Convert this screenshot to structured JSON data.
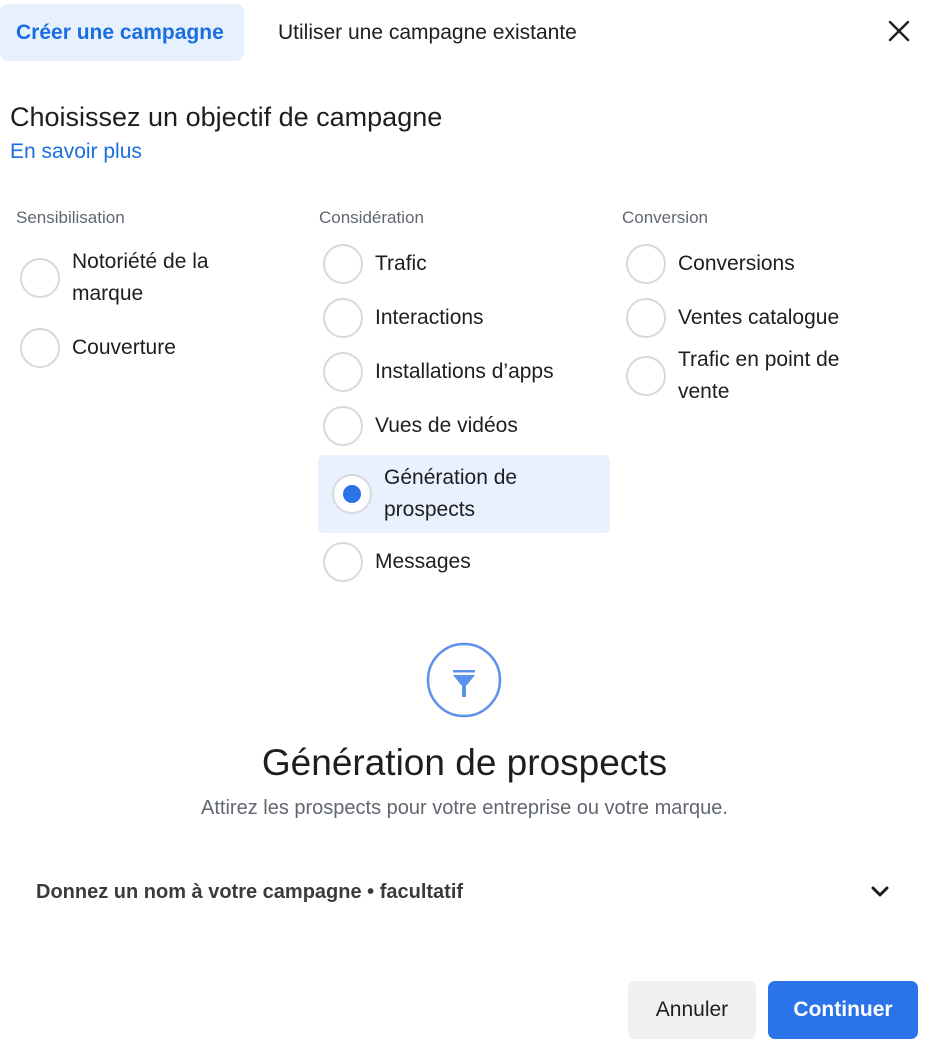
{
  "tabs": [
    {
      "label": "Créer une campagne",
      "active": true
    },
    {
      "label": "Utiliser une campagne existante",
      "active": false
    }
  ],
  "close_icon": "close-icon",
  "heading": "Choisissez un objectif de campagne",
  "learn_more": "En savoir plus",
  "columns": [
    {
      "title": "Sensibilisation",
      "options": [
        {
          "label": "Notoriété de la marque",
          "selected": false
        },
        {
          "label": "Couverture",
          "selected": false
        }
      ]
    },
    {
      "title": "Considération",
      "options": [
        {
          "label": "Trafic",
          "selected": false
        },
        {
          "label": "Interactions",
          "selected": false
        },
        {
          "label": "Installations d’apps",
          "selected": false
        },
        {
          "label": "Vues de vidéos",
          "selected": false
        },
        {
          "label": "Génération de prospects",
          "selected": true
        },
        {
          "label": "Messages",
          "selected": false
        }
      ]
    },
    {
      "title": "Conversion",
      "options": [
        {
          "label": "Conversions",
          "selected": false
        },
        {
          "label": "Ventes catalogue",
          "selected": false
        },
        {
          "label": "Trafic en point de vente",
          "selected": false
        }
      ]
    }
  ],
  "selected_objective": {
    "icon": "funnel-icon",
    "title": "Génération de prospects",
    "description": "Attirez les prospects pour votre entreprise ou votre marque."
  },
  "campaign_name": {
    "label": "Donnez un nom à votre campagne • facultatif",
    "icon": "chevron-down-icon"
  },
  "buttons": {
    "cancel": "Annuler",
    "continue": "Continuer"
  },
  "colors": {
    "accent": "#2a73e8",
    "selected_bg": "#e8f1fd",
    "link": "#1a6ee0"
  }
}
